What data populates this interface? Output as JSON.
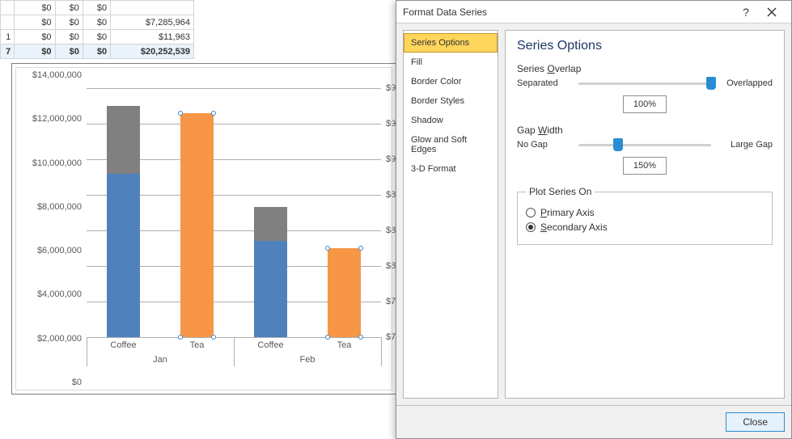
{
  "sheet": {
    "rows": [
      {
        "c0": "",
        "c1": "$0",
        "c2": "$0",
        "c3": "$0",
        "c4": ""
      },
      {
        "c0": "",
        "c1": "$0",
        "c2": "$0",
        "c3": "$0",
        "c4": "$7,285,964"
      },
      {
        "c0": "1",
        "c1": "$0",
        "c2": "$0",
        "c3": "$0",
        "c4": "$11,963"
      },
      {
        "c0": "7",
        "c1": "$0",
        "c2": "$0",
        "c3": "$0",
        "c4": "$20,252,539"
      }
    ]
  },
  "chart_data": {
    "type": "bar",
    "ylim": [
      0,
      14000000
    ],
    "ytick": 2000000,
    "categories": [
      {
        "group": "Jan",
        "label": "Coffee"
      },
      {
        "group": "Jan",
        "label": "Tea"
      },
      {
        "group": "Feb",
        "label": "Coffee"
      },
      {
        "group": "Feb",
        "label": "Tea"
      }
    ],
    "series_primary_stacked": [
      {
        "name": "blue",
        "color": "#4f81bd",
        "values": [
          9200000,
          0,
          5400000,
          0
        ]
      },
      {
        "name": "gray",
        "color": "#808080",
        "values": [
          3800000,
          0,
          1900000,
          0
        ]
      }
    ],
    "series_secondary": {
      "name": "orange",
      "color": "#f79646",
      "values": [
        0,
        12600000,
        0,
        5000000
      ],
      "selected": true
    },
    "y_axis_labels": [
      "$0",
      "$2,000,000",
      "$4,000,000",
      "$6,000,000",
      "$8,000,000",
      "$10,000,000",
      "$12,000,000",
      "$14,000,000"
    ],
    "y2_axis_labels_visible_prefixes": [
      "$7",
      "$7",
      "$8",
      "$8",
      "$8",
      "$9",
      "$9",
      "$9"
    ]
  },
  "dialog": {
    "title": "Format Data Series",
    "help": "?",
    "nav": [
      "Series Options",
      "Fill",
      "Border Color",
      "Border Styles",
      "Shadow",
      "Glow and Soft Edges",
      "3-D Format"
    ],
    "nav_selected": 0,
    "content": {
      "heading": "Series Options",
      "overlap": {
        "label": "Series Overlap",
        "left": "Separated",
        "right": "Overlapped",
        "value_pct": 100,
        "value_text": "100%"
      },
      "gap": {
        "label": "Gap Width",
        "left": "No Gap",
        "right": "Large Gap",
        "value_pct": 30,
        "value_text": "150%"
      },
      "plot_on": {
        "legend": "Plot Series On",
        "primary": "Primary Axis",
        "secondary": "Secondary Axis",
        "selected": "secondary"
      }
    },
    "close": "Close"
  }
}
